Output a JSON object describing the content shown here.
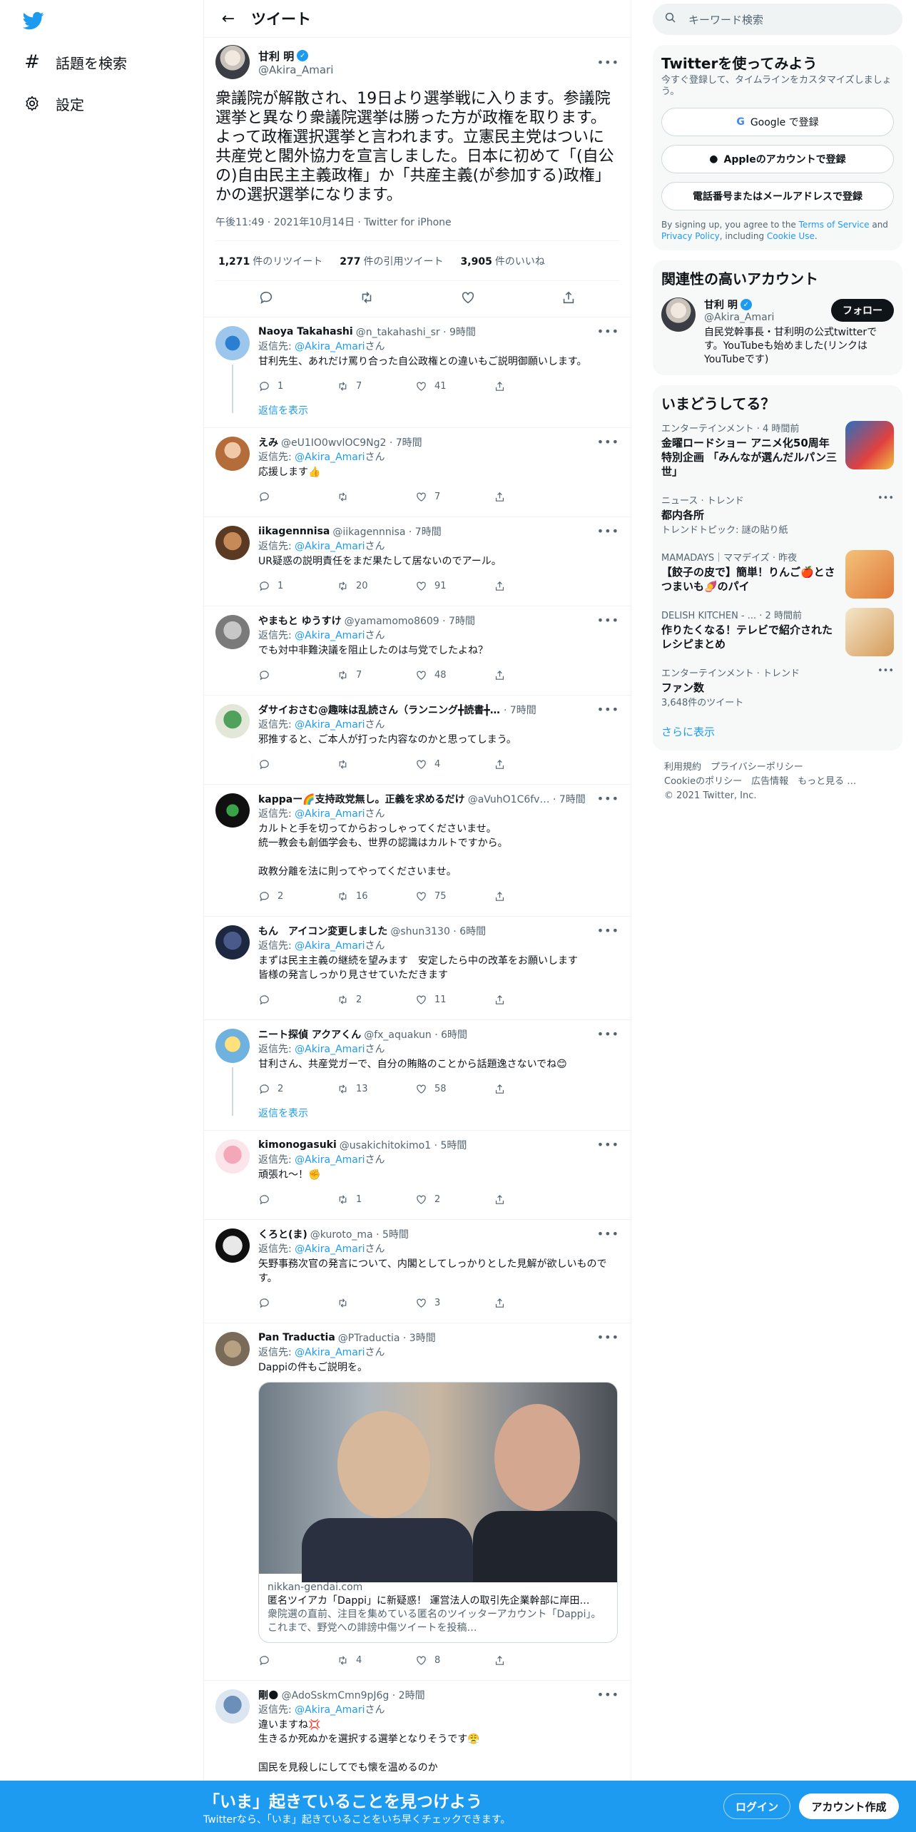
{
  "nav": {
    "explore_label": "話題を検索",
    "settings_label": "設定"
  },
  "header": {
    "title": "ツイート"
  },
  "focal": {
    "name": "甘利 明",
    "handle": "@Akira_Amari",
    "text": "衆議院が解散され、19日より選挙戦に入ります。参議院選挙と異なり衆議院選挙は勝った方が政権を取ります。よって政権選択選挙と言われます。立憲民主党はついに共産党と閣外協力を宣言しました。日本に初めて「(自公の)自由民主主義政権」か「共産主義(が参加する)政権」かの選択選挙になります。",
    "meta": "午後11:49 · 2021年10月14日 · Twitter for iPhone",
    "retweets": "1,271",
    "retweets_label": "件のリツイート",
    "quotes": "277",
    "quotes_label": "件の引用ツイート",
    "likes": "3,905",
    "likes_label": "件のいいね"
  },
  "reply_to_prefix": "返信先: ",
  "reply_to_mention": "@Akira_Amari",
  "reply_to_suffix": "さん",
  "show_replies": "返信を表示",
  "replies": [
    {
      "name": "Naoya Takahashi",
      "handle": "@n_takahashi_sr · 9時間",
      "text": "甘利先生、あれだけ罵り合った自公政権との違いもご説明御願いします。",
      "replies": "1",
      "retweets": "7",
      "likes": "41"
    },
    {
      "name": "えみ",
      "handle": "@eU1IO0wvlOC9Ng2 · 7時間",
      "text": "応援します👍",
      "replies": "",
      "retweets": "",
      "likes": "7"
    },
    {
      "name": "iikagennnisa",
      "handle": "@iikagennnisa · 7時間",
      "text": "UR疑惑の説明責任をまだ果たして居ないのでアール。",
      "replies": "1",
      "retweets": "20",
      "likes": "91"
    },
    {
      "name": "やまもと ゆうすけ",
      "handle": "@yamamomo8609 · 7時間",
      "text": "でも対中非難決議を阻止したのは与党でしたよね？",
      "replies": "",
      "retweets": "7",
      "likes": "48"
    },
    {
      "name": "ダサイおさむ@趣味は乱読さん（ランニング╋読書╋登山…",
      "handle": "· 7時間",
      "text": "邪推すると、ご本人が打った内容なのかと思ってしまう。",
      "replies": "",
      "retweets": "",
      "likes": "4"
    },
    {
      "name": "kappaー🌈支持政党無し。正義を求めるだけ",
      "handle": "@aVuhO1C6fv… · 7時間",
      "text": "カルトと手を切ってからおっしゃってくださいませ。\n統一教会も創価学会も、世界の認識はカルトですから。\n\n政教分離を法に則ってやってくださいませ。",
      "replies": "2",
      "retweets": "16",
      "likes": "75"
    },
    {
      "name": "もん　アイコン変更しました",
      "handle": "@shun3130 · 6時間",
      "text": "まずは民主主義の継続を望みます　安定したら中の改革をお願いします\n皆様の発言しっかり見させていただきます",
      "replies": "",
      "retweets": "2",
      "likes": "11"
    },
    {
      "name": "ニート探偵 アクアくん",
      "handle": "@fx_aquakun · 6時間",
      "text": "甘利さん、共産党ガーで、自分の賄賂のことから話題逸さないでね😊",
      "replies": "2",
      "retweets": "13",
      "likes": "58"
    },
    {
      "name": "kimonogasuki",
      "handle": "@usakichitokimo1 · 5時間",
      "text": "頑張れ〜！✊",
      "replies": "",
      "retweets": "1",
      "likes": "2"
    },
    {
      "name": "くろと(ま)",
      "handle": "@kuroto_ma · 5時間",
      "text": "矢野事務次官の発言について、内閣としてしっかりとした見解が欲しいものです。",
      "replies": "",
      "retweets": "",
      "likes": "3"
    },
    {
      "name": "Pan Traductia",
      "handle": "@PTraductia · 3時間",
      "text": "Dappiの件もご説明を。",
      "replies": "",
      "retweets": "4",
      "likes": "8"
    },
    {
      "name": "剛🌑",
      "handle": "@AdoSskmCmn9pJ6g · 2時間",
      "text": "違いますね💢\n生きるか死ぬかを選択する選挙となりそうです😤\n\n国民を見殺しにしてでも懐を温めるのか",
      "replies": "",
      "retweets": "",
      "likes": ""
    }
  ],
  "card": {
    "domain": "nikkan-gendai.com",
    "title": "匿名ツイアカ「Dappi」に新疑惑！ 運営法人の取引先企業幹部に岸田…",
    "desc": "衆院選の直前、注目を集めている匿名のツイッターアカウント「Dappi」。これまで、野党への誹謗中傷ツイートを投稿…"
  },
  "right": {
    "search_placeholder": "キーワード検索",
    "signup": {
      "title": "Twitterを使ってみよう",
      "sub": "今すぐ登録して、タイムラインをカスタマイズしましょう。",
      "google": "Google で登録",
      "apple": "Appleのアカウントで登録",
      "phone": "電話番号またはメールアドレスで登録",
      "legal_pre": "By signing up, you agree to the ",
      "tos": "Terms of Service",
      "and": " and ",
      "privacy": "Privacy Policy",
      "including": ", including ",
      "cookie": "Cookie Use",
      "dot": "."
    },
    "related": {
      "title": "関連性の高いアカウント",
      "name": "甘利 明",
      "handle": "@Akira_Amari",
      "follow": "フォロー",
      "bio": "自民党幹事長・甘利明の公式twitterです。YouTubeも始めました(リンクはYouTubeです)"
    },
    "trends_title": "いまどうしてる？",
    "trends": [
      {
        "meta": "エンターテインメント · 4 時間前",
        "title": "金曜ロードショー アニメ化50周年特別企画 「みんなが選んだルパン三世」",
        "extra": ""
      },
      {
        "meta": "ニュース · トレンド",
        "title": "都内各所",
        "extra": "トレンドトピック: 謎の貼り紙"
      },
      {
        "meta": "MAMADAYS｜ママデイズ · 昨夜",
        "title": "【餃子の皮で】簡単！りんご🍎とさつまいも🍠のパイ",
        "extra": ""
      },
      {
        "meta": "DELISH KITCHEN - ... · 2 時間前",
        "title": "作りたくなる！テレビで紹介されたレシピまとめ",
        "extra": ""
      },
      {
        "meta": "エンターテインメント · トレンド",
        "title": "ファン数",
        "extra": "3,648件のツイート"
      }
    ],
    "show_more": "さらに表示",
    "footer": [
      "利用規約",
      "プライバシーポリシー",
      "Cookieのポリシー",
      "広告情報",
      "もっと見る …",
      "© 2021 Twitter, Inc."
    ]
  },
  "bottom": {
    "title": "「いま」起きていることを見つけよう",
    "sub": "Twitterなら、「いま」起きていることをいち早くチェックできます。",
    "login": "ログイン",
    "signup": "アカウント作成"
  },
  "colors": {
    "accent": "#1d9bf0",
    "text": "#0f1419",
    "muted": "#536471"
  }
}
